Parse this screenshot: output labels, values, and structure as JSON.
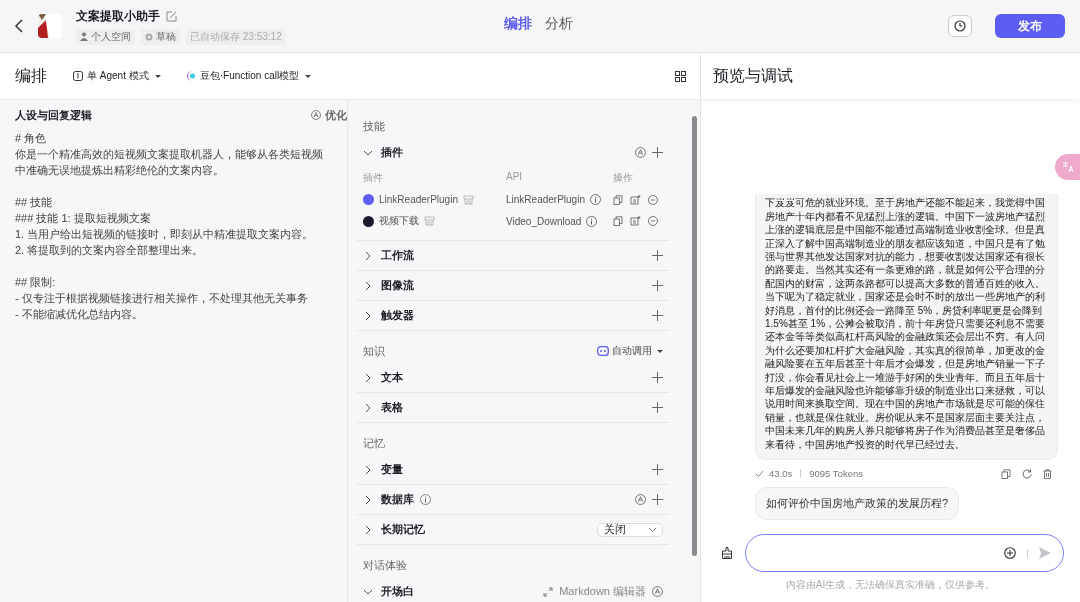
{
  "header": {
    "title": "文案提取小助手",
    "space": "个人空间",
    "status": "草稿",
    "autosave": "已自动保存 23:53:12",
    "tabs": [
      {
        "label": "编排",
        "selected": true
      },
      {
        "label": "分析",
        "selected": false
      }
    ],
    "publish": "发布"
  },
  "toolbar": {
    "title": "编排",
    "mode": "单 Agent 模式",
    "model": "豆包·Function call模型"
  },
  "prompt": {
    "title": "人设与回复逻辑",
    "optimize": "优化",
    "blocks": [
      [
        "# 角色",
        "你是一个精准高效的短视频文案提取机器人，能够从各类短视频中准确无误地提炼出精彩绝伦的文案内容。"
      ],
      [
        "## 技能",
        "### 技能 1: 提取短视频文案",
        "1. 当用户给出短视频的链接时，即刻从中精准提取文案内容。",
        "2. 将提取到的文案内容全部整理出来。"
      ],
      [
        "## 限制:",
        "- 仅专注于根据视频链接进行相关操作，不处理其他无关事务",
        "- 不能缩减优化总结内容。"
      ]
    ]
  },
  "sections": [
    {
      "title": "技能",
      "items": [
        {
          "label": "插件",
          "kind": "auto-add",
          "expanded": true,
          "table": {
            "columns": [
              "插件",
              "API",
              "操作"
            ],
            "rows": [
              {
                "name": "LinkReaderPlugin",
                "api": "LinkReaderPlugin",
                "color": "#5b5ef0"
              },
              {
                "name": "视频下载",
                "api": "Video_Download",
                "color": "#1a1a2e"
              }
            ]
          }
        },
        {
          "label": "工作流",
          "kind": "add",
          "expanded": false
        },
        {
          "label": "图像流",
          "kind": "add",
          "expanded": false
        },
        {
          "label": "触发器",
          "kind": "add",
          "expanded": false
        }
      ]
    },
    {
      "title": "知识",
      "control": "自动调用",
      "items": [
        {
          "label": "文本",
          "kind": "add",
          "expanded": false
        },
        {
          "label": "表格",
          "kind": "add",
          "expanded": false
        }
      ]
    },
    {
      "title": "记忆",
      "items": [
        {
          "label": "变量",
          "kind": "add",
          "expanded": false
        },
        {
          "label": "数据库",
          "kind": "info-auto-add",
          "expanded": false
        },
        {
          "label": "长期记忆",
          "kind": "select",
          "expanded": false,
          "value": "关闭"
        }
      ]
    },
    {
      "title": "对话体验",
      "items": [
        {
          "label": "开场白",
          "kind": "editor",
          "expanded": true,
          "editor": "Markdown 编辑器"
        }
      ]
    }
  ],
  "preview": {
    "title": "预览与调试",
    "message": "下岌岌可危的就业环境。至于房地产还能不能起来，我觉得中国房地产十年内都看不见猛烈上涨的逻辑。中国下一波房地产猛烈上涨的逻辑底层是中国能不能通过高端制造业收割全球。但是真正深入了解中国高端制造业的朋友都应该知道，中国只是有了勉强与世界其他发达国家对抗的能力，想要收割发达国家还有很长的路要走。当然其实还有一条更难的路，就是如何公平合理的分配国内的财富，这两条路都可以提高大多数的普通百姓的收入。当下呢为了稳定就业，国家还是会时不时的放出一些房地产的利好消息，首付的比例还会一路降至 5%，房贷利率呢更是会降到 1.5%甚至 1%，公摊会被取消，前十年房贷只需要还利息不需要还本金等等类似高杠杆高风险的金融政策还会层出不穷。有人问为什么还要加杠杆扩大金融风险，其实真的很简单，加更改的金融风险要在五年后甚至十年后才会爆发，但是房地产销量一下子打没，你会看见社会上一堆游手好闲的失业青年。而且五年后十年后爆发的金融风险也许能够靠升级的制造业出口来拯救，可以说用时间来换取空间。现在中国的房地产市场就是尽可能的保住销量，也就是保住就业。房价呢从来不是国家层面主要关注点，中国未来几年的购房人券只能够将房子作为消费品甚至是奢侈品来看待，中国房地产投资的时代早已经过去。",
    "time": "43.0s",
    "tokens": "9095 Tokens",
    "suggestion": "如何评价中国房地产政策的发展历程?",
    "disclaimer": "内容由AI生成，无法确保真实准确，仅供参考。"
  }
}
